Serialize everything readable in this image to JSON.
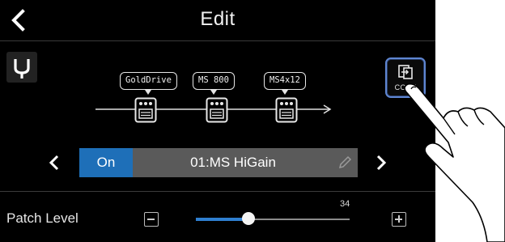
{
  "header": {
    "title": "Edit"
  },
  "effect_chain": {
    "effects": [
      {
        "name": "GoldDrive"
      },
      {
        "name": "MS 800"
      },
      {
        "name": "MS4x12"
      }
    ]
  },
  "copy_button": {
    "label": "COPY"
  },
  "patch": {
    "on_label": "On",
    "name": "01:MS HiGain"
  },
  "patch_level": {
    "label": "Patch Level",
    "value": "34",
    "value_fraction": 0.34
  },
  "colors": {
    "accent": "#1e6fb8",
    "copy_border": "#5f86d2",
    "slider_fill": "#2f7fd0"
  }
}
